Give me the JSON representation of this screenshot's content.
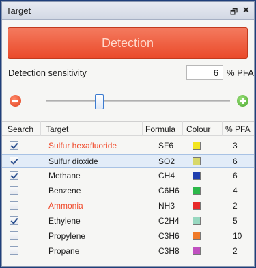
{
  "titlebar": {
    "title": "Target",
    "restore_glyph": "🗗",
    "close_glyph": "✕"
  },
  "detection": {
    "label": "Detection"
  },
  "sensitivity": {
    "label": "Detection sensitivity",
    "value": "6",
    "unit": "% PFA",
    "slider_value": 6
  },
  "table": {
    "headers": {
      "search": "Search",
      "target": "Target",
      "formula": "Formula",
      "colour": "Colour",
      "pfa": "% PFA"
    },
    "rows": [
      {
        "checked": true,
        "target": "Sulfur hexafluoride",
        "formula": "SF6",
        "colour": "#f2e51f",
        "pfa": "3",
        "alert": true
      },
      {
        "checked": true,
        "target": "Sulfur dioxide",
        "formula": "SO2",
        "colour": "#d8d86a",
        "pfa": "6",
        "alert": false,
        "selected": true
      },
      {
        "checked": true,
        "target": "Methane",
        "formula": "CH4",
        "colour": "#1f3fae",
        "pfa": "6",
        "alert": false
      },
      {
        "checked": false,
        "target": "Benzene",
        "formula": "C6H6",
        "colour": "#2cb84a",
        "pfa": "4",
        "alert": false
      },
      {
        "checked": false,
        "target": "Ammonia",
        "formula": "NH3",
        "colour": "#e82a2a",
        "pfa": "2",
        "alert": true
      },
      {
        "checked": true,
        "target": "Ethylene",
        "formula": "C2H4",
        "colour": "#98d8c0",
        "pfa": "5",
        "alert": false
      },
      {
        "checked": false,
        "target": "Propylene",
        "formula": "C3H6",
        "colour": "#f07a28",
        "pfa": "10",
        "alert": false
      },
      {
        "checked": false,
        "target": "Propane",
        "formula": "C3H8",
        "colour": "#c050c0",
        "pfa": "2",
        "alert": false
      }
    ]
  },
  "colors": {
    "accent": "#ea4a2a",
    "alert_text": "#f0492a",
    "title_bg": "#dde2ec"
  }
}
